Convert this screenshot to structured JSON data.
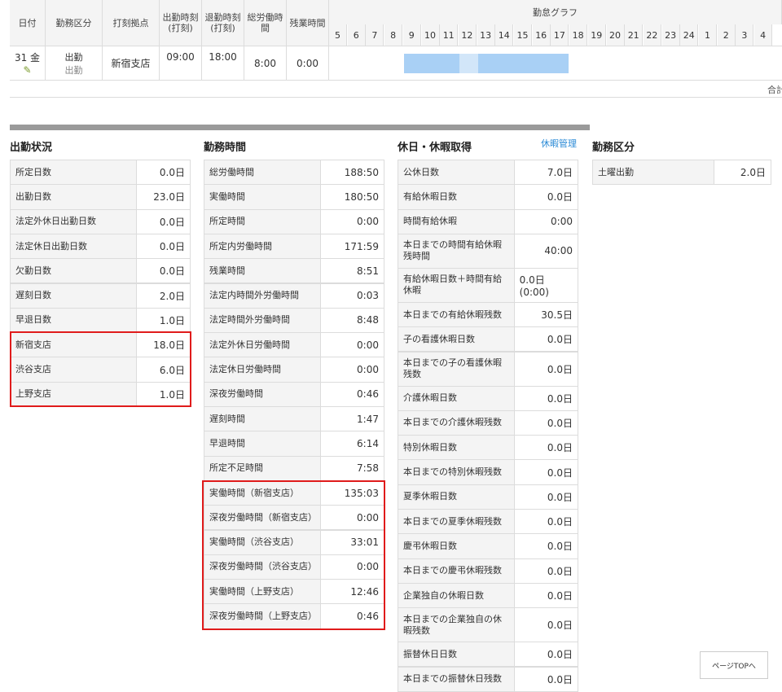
{
  "top": {
    "headers": {
      "date": "日付",
      "work_type": "勤務区分",
      "stamp_location": "打刻拠点",
      "clock_in": "出勤時刻\n(打刻)",
      "clock_out": "退勤時刻\n(打刻)",
      "total_work": "総労働時\n間",
      "overtime": "残業時間",
      "graph": "勤怠グラフ"
    },
    "hours": [
      "5",
      "6",
      "7",
      "8",
      "9",
      "10",
      "11",
      "12",
      "13",
      "14",
      "15",
      "16",
      "17",
      "18",
      "19",
      "20",
      "21",
      "22",
      "23",
      "24",
      "1",
      "2",
      "3",
      "4"
    ],
    "row": {
      "date": "31 金",
      "work_type_main": "出勤",
      "work_type_sub": "出勤",
      "stamp_location": "新宿支店",
      "clock_in": "09:00",
      "clock_out": "18:00",
      "total_work": "8:00",
      "overtime": "0:00",
      "bar_start_hour": 9,
      "bar_end_hour": 18,
      "break_start_hour": 12,
      "break_end_hour": 13
    },
    "summary_label": "合計",
    "colors": {
      "bar": "#a9d0f5",
      "break": "#d2e6f9"
    },
    "edit_icon": "pencil-icon"
  },
  "sections": {
    "attendance": {
      "title": "出勤状況",
      "rows": [
        {
          "label": "所定日数",
          "value": "0.0日"
        },
        {
          "label": "出勤日数",
          "value": "23.0日"
        },
        {
          "label": "法定外休日出勤日数",
          "value": "0.0日"
        },
        {
          "label": "法定休日出勤日数",
          "value": "0.0日"
        },
        {
          "label": "欠勤日数",
          "value": "0.0日"
        },
        {
          "label": "遅刻日数",
          "value": "2.0日"
        },
        {
          "label": "早退日数",
          "value": "1.0日"
        },
        {
          "label": "新宿支店",
          "value": "18.0日"
        },
        {
          "label": "渋谷支店",
          "value": "6.0日"
        },
        {
          "label": "上野支店",
          "value": "1.0日"
        }
      ]
    },
    "worktime": {
      "title": "勤務時間",
      "rows": [
        {
          "label": "総労働時間",
          "value": "188:50"
        },
        {
          "label": "実働時間",
          "value": "180:50"
        },
        {
          "label": "所定時間",
          "value": "0:00"
        },
        {
          "label": "所定内労働時間",
          "value": "171:59"
        },
        {
          "label": "残業時間",
          "value": "8:51"
        },
        {
          "label": "法定内時間外労働時間",
          "value": "0:03"
        },
        {
          "label": "法定時間外労働時間",
          "value": "8:48"
        },
        {
          "label": "法定外休日労働時間",
          "value": "0:00"
        },
        {
          "label": "法定休日労働時間",
          "value": "0:00"
        },
        {
          "label": "深夜労働時間",
          "value": "0:46"
        },
        {
          "label": "遅刻時間",
          "value": "1:47"
        },
        {
          "label": "早退時間",
          "value": "6:14"
        },
        {
          "label": "所定不足時間",
          "value": "7:58"
        },
        {
          "label": "実働時間（新宿支店）",
          "value": "135:03"
        },
        {
          "label": "深夜労働時間（新宿支店）",
          "value": "0:00"
        },
        {
          "label": "実働時間（渋谷支店）",
          "value": "33:01"
        },
        {
          "label": "深夜労働時間（渋谷支店）",
          "value": "0:00"
        },
        {
          "label": "実働時間（上野支店）",
          "value": "12:46"
        },
        {
          "label": "深夜労働時間（上野支店）",
          "value": "0:46"
        }
      ]
    },
    "holiday": {
      "title": "休日・休暇取得",
      "link": "休暇管理",
      "rows": [
        {
          "label": "公休日数",
          "value": "7.0日"
        },
        {
          "label": "有給休暇日数",
          "value": "0.0日"
        },
        {
          "label": "時間有給休暇",
          "value": "0:00"
        },
        {
          "label": "本日までの時間有給休暇残時間",
          "value": "40:00",
          "tall": true
        },
        {
          "label": "有給休暇日数＋時間有給休暇",
          "value": "0.0日 (0:00)",
          "tall": true
        },
        {
          "label": "本日までの有給休暇残数",
          "value": "30.5日"
        },
        {
          "label": "子の看護休暇日数",
          "value": "0.0日"
        },
        {
          "label": "本日までの子の看護休暇残数",
          "value": "0.0日",
          "tall": true
        },
        {
          "label": "介護休暇日数",
          "value": "0.0日"
        },
        {
          "label": "本日までの介護休暇残数",
          "value": "0.0日"
        },
        {
          "label": "特別休暇日数",
          "value": "0.0日"
        },
        {
          "label": "本日までの特別休暇残数",
          "value": "0.0日"
        },
        {
          "label": "夏季休暇日数",
          "value": "0.0日"
        },
        {
          "label": "本日までの夏季休暇残数",
          "value": "0.0日"
        },
        {
          "label": "慶弔休暇日数",
          "value": "0.0日"
        },
        {
          "label": "本日までの慶弔休暇残数",
          "value": "0.0日"
        },
        {
          "label": "企業独自の休暇日数",
          "value": "0.0日"
        },
        {
          "label": "本日までの企業独自の休暇残数",
          "value": "0.0日",
          "tall": true
        },
        {
          "label": "振替休日日数",
          "value": "0.0日"
        },
        {
          "label": "本日までの振替休日残数",
          "value": "0.0日"
        }
      ]
    },
    "worktype": {
      "title": "勤務区分",
      "rows": [
        {
          "label": "土曜出勤",
          "value": "2.0日"
        }
      ]
    }
  },
  "page_top": "ページTOPへ"
}
